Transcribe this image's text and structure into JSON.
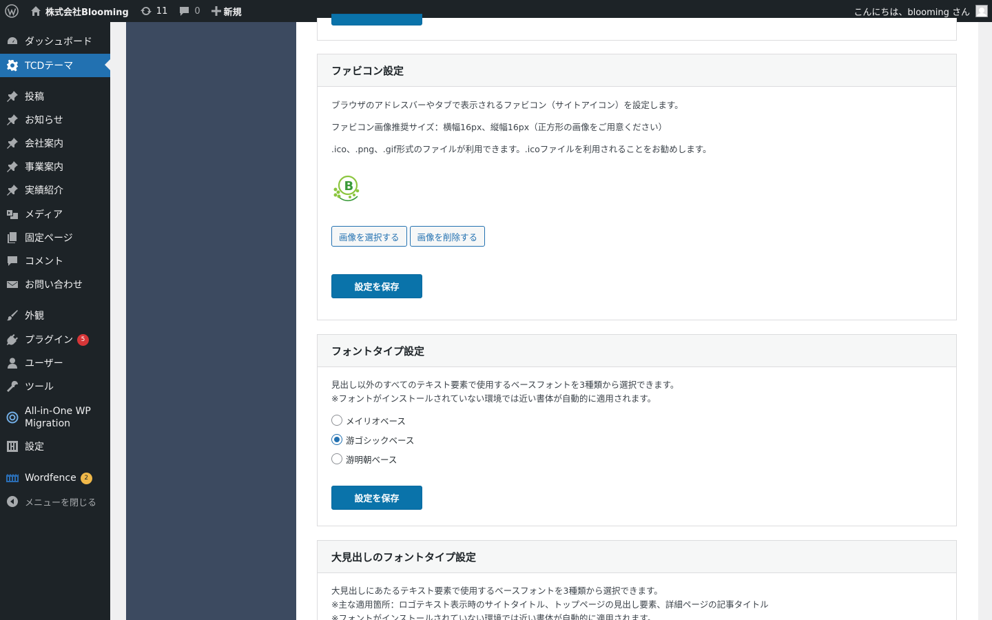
{
  "adminbar": {
    "site_name": "株式会社Blooming",
    "updates_count": "11",
    "comments_count": "0",
    "new_label": "新規",
    "greeting": "こんにちは、blooming さん"
  },
  "sidebar": {
    "items": [
      {
        "label": "ダッシュボード"
      },
      {
        "label": "TCDテーマ"
      },
      {
        "label": "投稿"
      },
      {
        "label": "お知らせ"
      },
      {
        "label": "会社案内"
      },
      {
        "label": "事業案内"
      },
      {
        "label": "実績紹介"
      },
      {
        "label": "メディア"
      },
      {
        "label": "固定ページ"
      },
      {
        "label": "コメント"
      },
      {
        "label": "お問い合わせ"
      },
      {
        "label": "外観"
      },
      {
        "label": "プラグイン",
        "badge": "5"
      },
      {
        "label": "ユーザー"
      },
      {
        "label": "ツール"
      },
      {
        "label_line1": "All-in-One WP",
        "label_line2": "Migration"
      },
      {
        "label": "設定"
      },
      {
        "label": "Wordfence",
        "badge": "2"
      },
      {
        "label": "メニューを閉じる"
      }
    ]
  },
  "favicon": {
    "title": "ファビコン設定",
    "desc1": "ブラウザのアドレスバーやタブで表示されるファビコン（サイトアイコン）を設定します。",
    "desc2": "ファビコン画像推奨サイズ：横幅16px、縦幅16px（正方形の画像をご用意ください）",
    "desc3": ".ico、.png、.gif形式のファイルが利用できます。.icoファイルを利用されることをお勧めします。",
    "logo_letter": "B",
    "select_label": "画像を選択する",
    "delete_label": "画像を削除する",
    "save_label": "設定を保存"
  },
  "fonttype": {
    "title": "フォントタイプ設定",
    "desc1": "見出し以外のすべてのテキスト要素で使用するベースフォントを3種類から選択できます。",
    "desc2": "※フォントがインストールされていない環境では近い書体が自動的に適用されます。",
    "options": [
      {
        "label": "メイリオベース",
        "checked": false
      },
      {
        "label": "游ゴシックベース",
        "checked": true
      },
      {
        "label": "游明朝ベース",
        "checked": false
      }
    ],
    "save_label": "設定を保存"
  },
  "heading_font": {
    "title": "大見出しのフォントタイプ設定",
    "desc1": "大見出しにあたるテキスト要素で使用するベースフォントを3種類から選択できます。",
    "desc2": "※主な適用箇所：ロゴテキスト表示時のサイトタイトル、トップページの見出し要素、詳細ページの記事タイトル",
    "desc3": "※フォントがインストールされていない環境では近い書体が自動的に適用されます。"
  },
  "colors": {
    "adminbar_bg": "#1d2327",
    "primary_blue": "#0a73aa",
    "current_menu": "#2271b1",
    "tcd_nav_bg": "#3c4a60",
    "badge_red": "#d63638",
    "badge_orange": "#f0b849"
  }
}
